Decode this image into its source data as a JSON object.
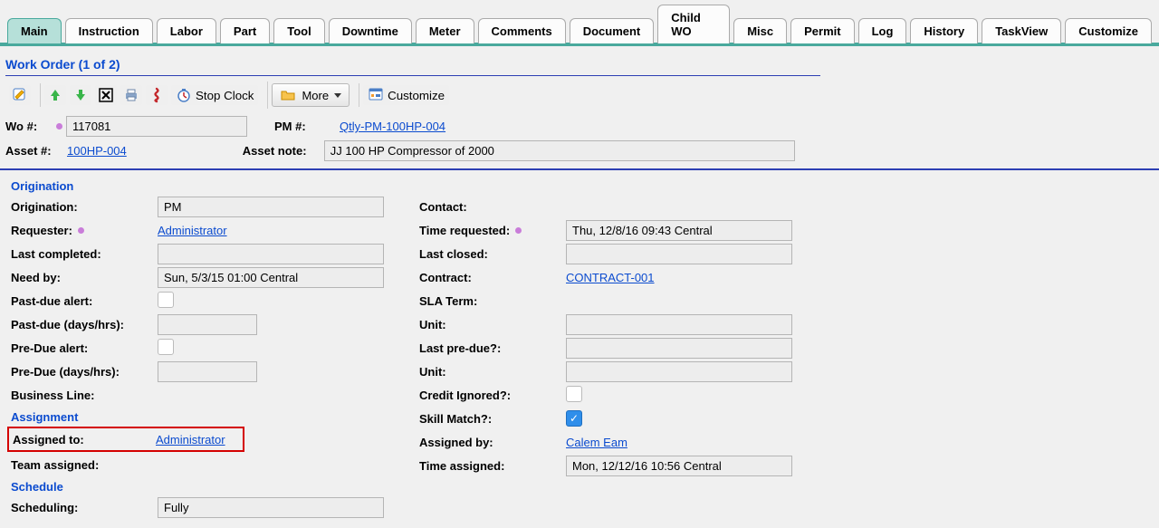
{
  "tabs": [
    "Main",
    "Instruction",
    "Labor",
    "Part",
    "Tool",
    "Downtime",
    "Meter",
    "Comments",
    "Document",
    "Child WO",
    "Misc",
    "Permit",
    "Log",
    "History",
    "TaskView",
    "Customize"
  ],
  "active_tab": "Main",
  "section_title": "Work Order (1 of 2)",
  "toolbar": {
    "stopclock_label": "Stop Clock",
    "more_label": "More",
    "customize_label": "Customize"
  },
  "header": {
    "wo_label": "Wo #:",
    "wo_value": "117081",
    "pm_label": "PM #:",
    "pm_value": "Qtly-PM-100HP-004",
    "asset_label": "Asset #:",
    "asset_value": "100HP-004",
    "asset_note_label": "Asset note:",
    "asset_note_value": "JJ 100 HP Compressor of 2000"
  },
  "origination": {
    "title": "Origination",
    "origination_label": "Origination:",
    "origination_value": "PM",
    "requester_label": "Requester:",
    "requester_value": "Administrator",
    "last_completed_label": "Last completed:",
    "last_completed_value": "",
    "needby_label": "Need by:",
    "needby_value": "Sun, 5/3/15 01:00 Central",
    "pastdue_alert_label": "Past-due alert:",
    "pastdue_days_label": "Past-due (days/hrs):",
    "pastdue_days_value": "",
    "predue_alert_label": "Pre-Due alert:",
    "predue_days_label": "Pre-Due (days/hrs):",
    "predue_days_value": "",
    "business_line_label": "Business Line:",
    "contact_label": "Contact:",
    "time_requested_label": "Time requested:",
    "time_requested_value": "Thu, 12/8/16 09:43 Central",
    "last_closed_label": "Last closed:",
    "last_closed_value": "",
    "contract_label": "Contract:",
    "contract_value": "CONTRACT-001",
    "sla_term_label": "SLA Term:",
    "unit1_label": "Unit:",
    "unit1_value": "",
    "last_predue_label": "Last pre-due?:",
    "last_predue_value": "",
    "unit2_label": "Unit:",
    "unit2_value": "",
    "credit_ignored_label": "Credit Ignored?:",
    "skill_match_label": "Skill Match?:"
  },
  "assignment": {
    "title": "Assignment",
    "assigned_to_label": "Assigned to:",
    "assigned_to_value": "Administrator",
    "team_assigned_label": "Team assigned:",
    "assigned_by_label": "Assigned by:",
    "assigned_by_value": "Calem Eam",
    "time_assigned_label": "Time assigned:",
    "time_assigned_value": "Mon, 12/12/16 10:56 Central"
  },
  "schedule": {
    "title": "Schedule",
    "scheduling_label": "Scheduling:",
    "scheduling_value": "Fully"
  }
}
